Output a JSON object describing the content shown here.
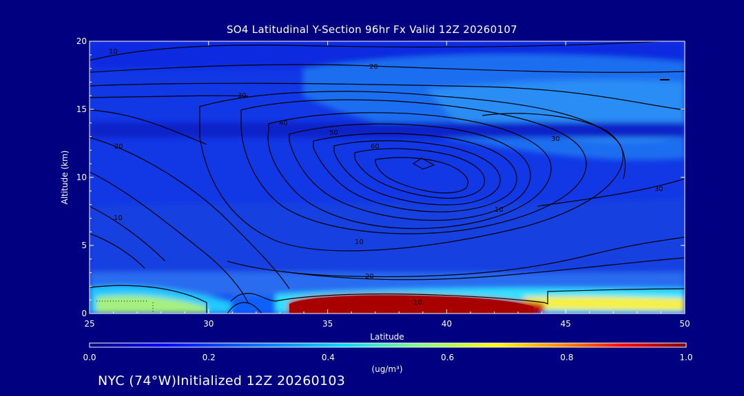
{
  "chart_data": {
    "type": "heatmap",
    "title": "SO4 Latitudinal Y-Section 96hr  Fx Valid 12Z 20260107",
    "xlabel": "Latitude",
    "ylabel": "Altitude (km)",
    "xlim": [
      25,
      50
    ],
    "ylim": [
      0,
      20
    ],
    "x_ticks": [
      "25",
      "30",
      "35",
      "40",
      "45",
      "50"
    ],
    "y_ticks": [
      "0",
      "5",
      "10",
      "15",
      "20"
    ],
    "colorbar": {
      "range": [
        0.0,
        1.0
      ],
      "ticks": [
        "0.0",
        "0.2",
        "0.4",
        "0.6",
        "0.8",
        "1.0"
      ],
      "unit_label": "(ug/m³)",
      "colors": [
        "#000080",
        "#0000ff",
        "#0080ff",
        "#00d8ff",
        "#80ff80",
        "#ffff00",
        "#ff8000",
        "#ff0000",
        "#800000"
      ]
    },
    "contour_labels": [
      "10",
      "20",
      "30",
      "40",
      "50",
      "60"
    ],
    "field_summary": [
      {
        "region": "surface layer 33.5N–44N, 0–1 km",
        "value": 1.0
      },
      {
        "region": "surface layer 44N–50N, 0–1 km",
        "value": 0.65
      },
      {
        "region": "surface layer 25N–30N, 0–1 km",
        "value": 0.45
      },
      {
        "region": "upper troposphere 36N–50N, 13–17 km",
        "value": 0.25
      },
      {
        "region": "background",
        "value": 0.12
      }
    ]
  },
  "footer": {
    "text": "NYC (74°W)Initialized 12Z 20260103"
  }
}
